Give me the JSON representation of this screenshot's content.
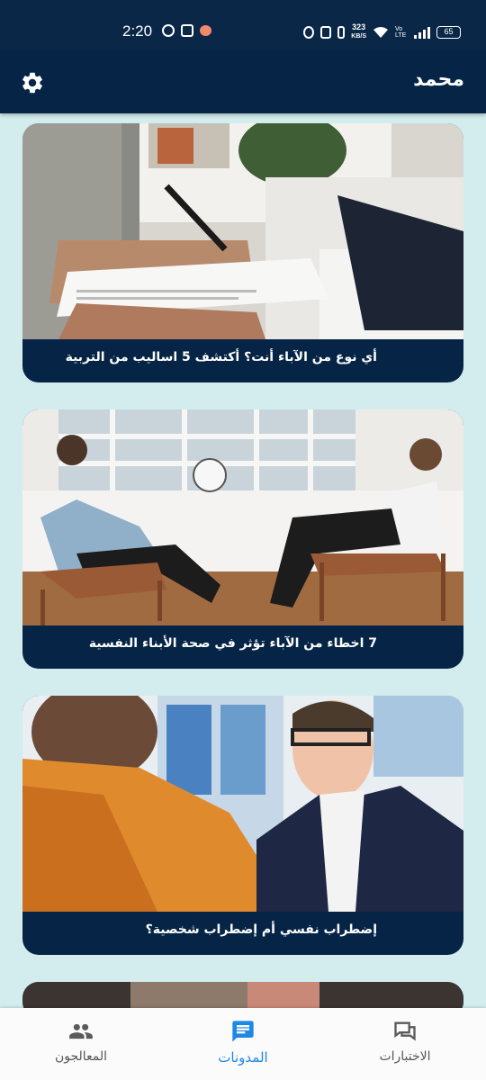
{
  "status_bar": {
    "time": "2:20",
    "network_speed": "323",
    "network_speed_unit": "KB/S",
    "network_type": "Vo LTE",
    "battery": "65"
  },
  "app_bar": {
    "title": "محمد",
    "settings_icon": "gear-icon"
  },
  "blogs": [
    {
      "title": "أي نوع من الآباء أنت؟ أكتشف 5 اساليب من التربية"
    },
    {
      "title": "7 اخطاء من الآباء تؤثر في صحة الأبناء النفسية"
    },
    {
      "title": "إضطراب نفسي أم إضطراب شخصية؟"
    }
  ],
  "bottom_nav": {
    "items": [
      {
        "label": "المعالجون",
        "icon": "people-icon",
        "active": false
      },
      {
        "label": "المدونات",
        "icon": "chat-bubble-icon",
        "active": true
      },
      {
        "label": "الاختبارات",
        "icon": "forum-icon",
        "active": false
      }
    ]
  },
  "colors": {
    "app_bar": "#062546",
    "background": "#d3ecee",
    "active_nav": "#1e88e5",
    "inactive_nav": "#555555"
  }
}
